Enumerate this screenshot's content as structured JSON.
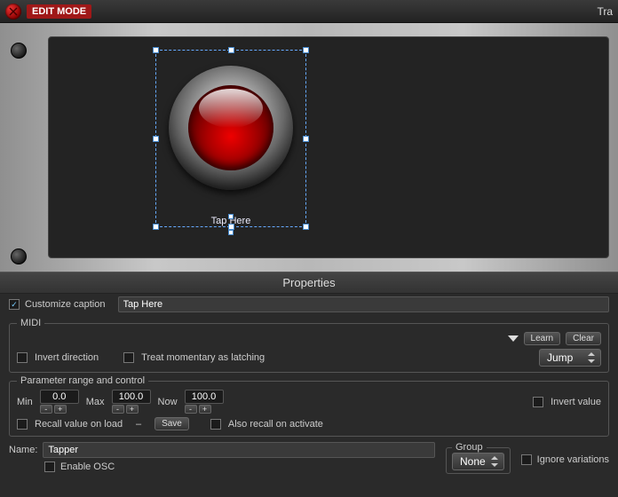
{
  "topbar": {
    "mode_label": "EDIT MODE",
    "right_text": "Tra"
  },
  "canvas": {
    "caption": "Tap Here"
  },
  "properties": {
    "title": "Properties",
    "customize_caption_label": "Customize caption",
    "customize_caption_checked": true,
    "caption_value": "Tap Here",
    "midi": {
      "legend": "MIDI",
      "learn": "Learn",
      "clear": "Clear",
      "invert_direction": "Invert direction",
      "treat_momentary": "Treat momentary as latching",
      "mode_value": "Jump"
    },
    "param": {
      "legend": "Parameter range and control",
      "min_label": "Min",
      "min_value": "0.0",
      "max_label": "Max",
      "max_value": "100.0",
      "now_label": "Now",
      "now_value": "100.0",
      "invert_value": "Invert value",
      "recall_on_load": "Recall value on load",
      "recall_indicator": "–",
      "save": "Save",
      "also_recall": "Also recall on activate"
    },
    "name_label": "Name:",
    "name_value": "Tapper",
    "enable_osc": "Enable OSC",
    "group_label": "Group",
    "group_value": "None",
    "ignore_variations": "Ignore variations"
  }
}
